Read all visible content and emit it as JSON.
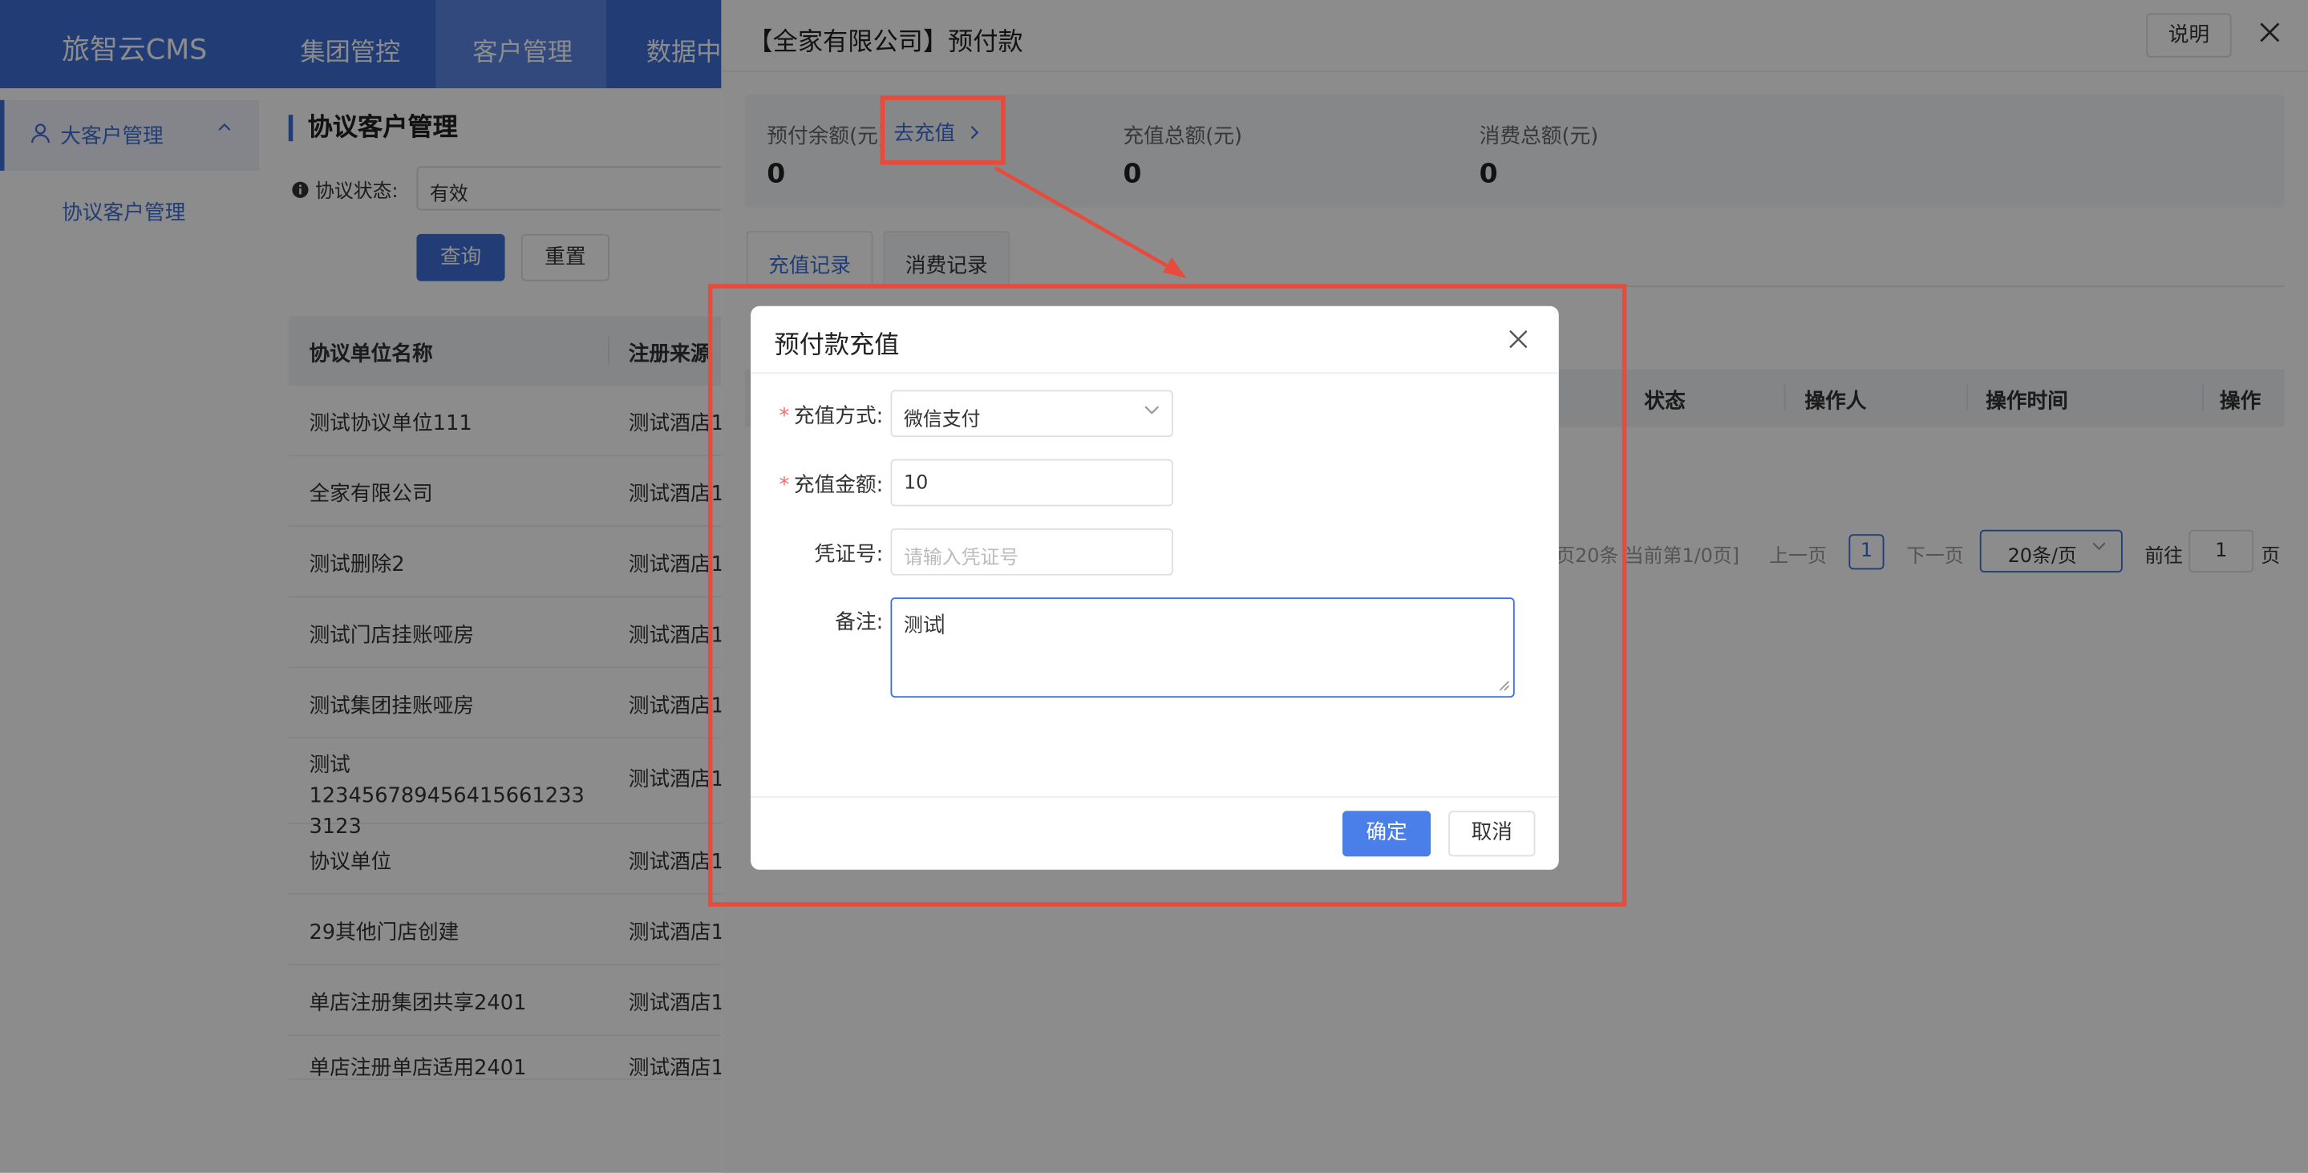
{
  "app": {
    "logo": "旅智云CMS",
    "nav": [
      "集团管控",
      "客户管理",
      "数据中"
    ]
  },
  "sidebar": {
    "group_label": "大客户管理",
    "sub_item": "协议客户管理"
  },
  "main": {
    "title": "协议客户管理",
    "filter_label": "协议状态:",
    "filter_value": "有效",
    "query_button": "查询",
    "reset_button": "重置",
    "columns": [
      "协议单位名称",
      "注册来源"
    ],
    "rows": [
      [
        "测试协议单位111",
        "测试酒店1"
      ],
      [
        "全家有限公司",
        "测试酒店1"
      ],
      [
        "测试删除2",
        "测试酒店1"
      ],
      [
        "测试门店挂账哑房",
        "测试酒店1"
      ],
      [
        "测试集团挂账哑房",
        "测试酒店1"
      ],
      [
        "测试123456789456415661233\n3123",
        "测试酒店1"
      ],
      [
        "协议单位",
        "测试酒店1"
      ],
      [
        "29其他门店创建",
        "测试酒店1"
      ],
      [
        "单店注册集团共享2401",
        "测试酒店1"
      ],
      [
        "单店注册单店适用2401",
        "测试酒店1"
      ]
    ]
  },
  "drawer": {
    "title": "【全家有限公司】预付款",
    "explain_button": "说明",
    "stats": [
      {
        "label": "预付余额(元)",
        "value": "0"
      },
      {
        "label": "充值总额(元)",
        "value": "0"
      },
      {
        "label": "消费总额(元)",
        "value": "0"
      }
    ],
    "recharge_link": "去充值",
    "tabs": [
      "充值记录",
      "消费记录"
    ],
    "table_columns": [
      "状态",
      "操作人",
      "操作时间",
      "操作"
    ],
    "pager": {
      "summary": "页20条 当前第1/0页]",
      "prev": "上一页",
      "page": "1",
      "next": "下一页",
      "page_size": "20条/页",
      "goto_label": "前往",
      "goto_value": "1",
      "goto_suffix": "页"
    }
  },
  "modal": {
    "title": "预付款充值",
    "fields": {
      "method": {
        "label": "充值方式:",
        "value": "微信支付"
      },
      "amount": {
        "label": "充值金额:",
        "value": "10"
      },
      "voucher": {
        "label": "凭证号:",
        "placeholder": "请输入凭证号"
      },
      "remark": {
        "label": "备注:",
        "value": "测试"
      }
    },
    "ok_button": "确定",
    "cancel_button": "取消"
  },
  "colors": {
    "primary": "#3e6fd8",
    "annotation": "#e84a3c"
  }
}
